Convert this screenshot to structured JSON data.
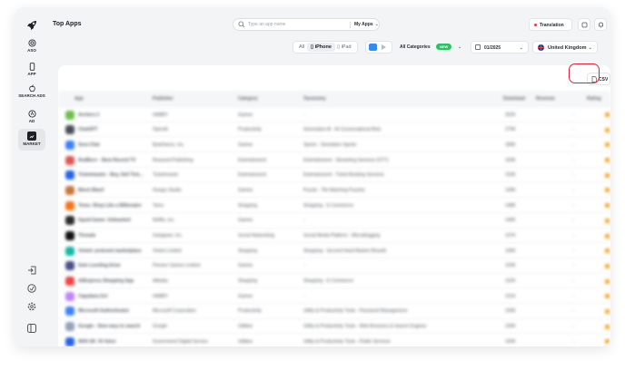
{
  "sidebar": {
    "items": [
      {
        "label": "ASO",
        "icon": "target-icon"
      },
      {
        "label": "APP",
        "icon": "phone-icon"
      },
      {
        "label": "SEARCH ADS",
        "icon": "apple-icon"
      },
      {
        "label": "AD",
        "icon": "ad-icon"
      },
      {
        "label": "MARKET",
        "icon": "market-icon"
      }
    ]
  },
  "header": {
    "title": "Top Apps",
    "search_placeholder": "Type an app name",
    "my_apps": "My Apps",
    "translation": "Translation"
  },
  "filters": {
    "all": "All",
    "iphone": "iPhone",
    "ipad": "iPad",
    "categories": "All Categories",
    "new_badge": "NEW",
    "date": "01/2025",
    "country": "United Kingdom"
  },
  "csv_label": "CSV",
  "colors": {
    "accent": "#2f8cf6",
    "new_badge": "#22c55e",
    "highlight": "#e0203a",
    "rating": "#f5a623"
  },
  "table": {
    "headers": [
      "App",
      "Publisher",
      "Category",
      "Taxonomy",
      "Download",
      "Revenue",
      "Rating"
    ],
    "rows": [
      {
        "app": "Archero 2",
        "publisher": "HABBY",
        "category": "Games",
        "taxonomy": "–",
        "download": "352K",
        "revenue": "–",
        "color": "#6dbf4b"
      },
      {
        "app": "ChatGPT",
        "publisher": "OpenAI",
        "category": "Productivity",
        "taxonomy": "Generative AI - AI Conversational Bots",
        "download": "279K",
        "revenue": "–",
        "color": "#4b4f55"
      },
      {
        "app": "Sora Chat",
        "publisher": "ByteDance, Inc.",
        "category": "Games",
        "taxonomy": "Sports - Simulation Sports",
        "download": "189K",
        "revenue": "–",
        "color": "#3b82f6"
      },
      {
        "app": "RedBox+ : Best Record TV",
        "publisher": "Reazand Publishing",
        "category": "Entertainment",
        "taxonomy": "Entertainment - Streaming Services (OTT)",
        "download": "169K",
        "revenue": "–",
        "color": "#e25555"
      },
      {
        "app": "Ticketmaster - Buy, Sell Tick...",
        "publisher": "Ticketmaster",
        "category": "Entertainment",
        "taxonomy": "Entertainment - Ticket Booking Services",
        "download": "153K",
        "revenue": "–",
        "color": "#2563eb"
      },
      {
        "app": "Block Blast!",
        "publisher": "Hungry Studio",
        "category": "Games",
        "taxonomy": "Puzzle - Tile Matching Puzzles",
        "download": "149K",
        "revenue": "–",
        "color": "#c57a3a"
      },
      {
        "app": "Temu: Shop Like a Billionaire",
        "publisher": "Temu",
        "category": "Shopping",
        "taxonomy": "Shopping - E-Commerce",
        "download": "148K",
        "revenue": "–",
        "color": "#f97316"
      },
      {
        "app": "Squid Game: Unleashed",
        "publisher": "Netflix, Inc.",
        "category": "Games",
        "taxonomy": "–",
        "download": "146K",
        "revenue": "–",
        "color": "#2b2b2b"
      },
      {
        "app": "Threads",
        "publisher": "Instagram, Inc.",
        "category": "Social Networking",
        "taxonomy": "Social Media Platform - Microblogging",
        "download": "107K",
        "revenue": "–",
        "color": "#111111"
      },
      {
        "app": "Vinted: preloved marketplace",
        "publisher": "Vinted Limited",
        "category": "Shopping",
        "taxonomy": "Shopping - Second Hand Market (Resell)",
        "download": "105K",
        "revenue": "–",
        "color": "#14b8a6"
      },
      {
        "app": "Solo Leveling:Arise",
        "publisher": "Pioneer Games Limited",
        "category": "Games",
        "taxonomy": "–",
        "download": "103K",
        "revenue": "–",
        "color": "#4c4f8a"
      },
      {
        "app": "AliExpress Shopping App",
        "publisher": "Alibaba",
        "category": "Shopping",
        "taxonomy": "Shopping - E-Commerce",
        "download": "102K",
        "revenue": "–",
        "color": "#ef4444"
      },
      {
        "app": "Capybara Go!",
        "publisher": "HABBY",
        "category": "Games",
        "taxonomy": "–",
        "download": "101K",
        "revenue": "–",
        "color": "#c084fc"
      },
      {
        "app": "Microsoft Authenticator",
        "publisher": "Microsoft Corporation",
        "category": "Productivity",
        "taxonomy": "Utility & Productivity Tools - Password Management",
        "download": "100K",
        "revenue": "–",
        "color": "#3b82f6"
      },
      {
        "app": "Google - Now easy to search",
        "publisher": "Google",
        "category": "Utilities",
        "taxonomy": "Utility & Productivity Tools - Web Browsers & Search Engines",
        "download": "100K",
        "revenue": "–",
        "color": "#94a3b8"
      },
      {
        "app": "NHS UK: Hi Voice",
        "publisher": "Government Digital Service",
        "category": "Utilities",
        "taxonomy": "Utility & Productivity Tools - Public Services",
        "download": "100K",
        "revenue": "–",
        "color": "#2563eb"
      }
    ]
  }
}
